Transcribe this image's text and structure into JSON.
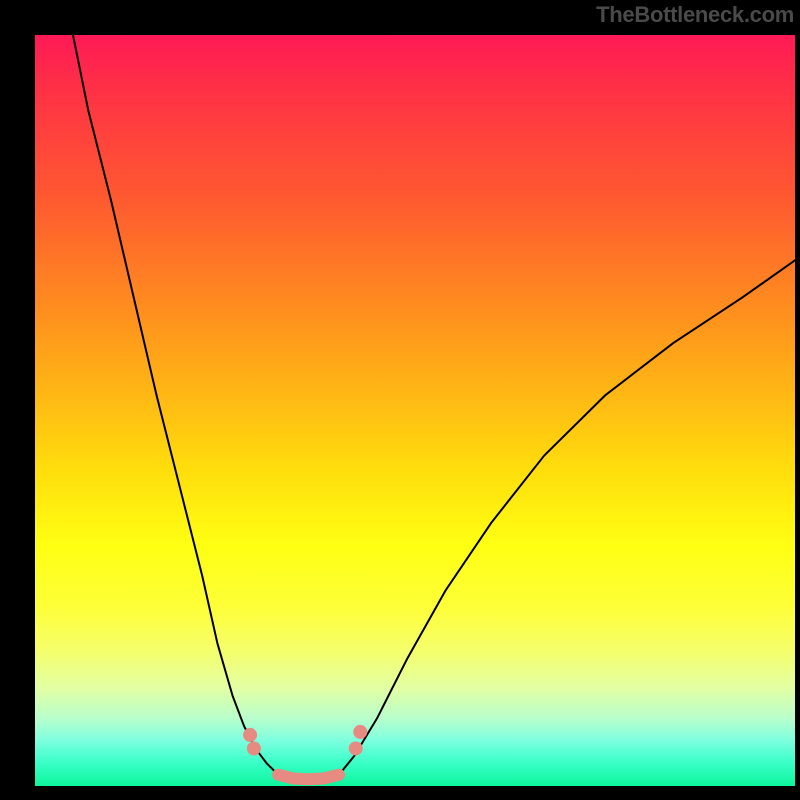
{
  "watermark": "TheBottleneck.com",
  "chart_data": {
    "type": "line",
    "title": "",
    "xlabel": "",
    "ylabel": "",
    "xlim": [
      0,
      100
    ],
    "ylim": [
      0,
      100
    ],
    "background": "rainbow-gradient",
    "series": [
      {
        "name": "left-curve",
        "x": [
          5,
          7,
          10,
          13,
          16,
          19,
          22,
          24,
          26,
          27.5,
          29,
          30.5,
          32
        ],
        "y": [
          100,
          90,
          78,
          65,
          52,
          40,
          28,
          19,
          12,
          8,
          5,
          3,
          1.5
        ],
        "stroke": "#000",
        "width": 2
      },
      {
        "name": "right-curve",
        "x": [
          40,
          42,
          45,
          49,
          54,
          60,
          67,
          75,
          84,
          93,
          100
        ],
        "y": [
          1.5,
          4,
          9,
          17,
          26,
          35,
          44,
          52,
          59,
          65,
          70
        ],
        "stroke": "#000",
        "width": 2
      },
      {
        "name": "bottom-connector",
        "x": [
          32,
          34,
          36,
          38,
          40
        ],
        "y": [
          1.5,
          1.0,
          0.9,
          1.0,
          1.5
        ],
        "stroke": "#e68a82",
        "width": 12
      },
      {
        "name": "left-beads",
        "type": "scatter",
        "x": [
          28.3,
          28.8
        ],
        "y": [
          6.8,
          5.0
        ],
        "marker_color": "#e68a82",
        "marker_size": 14
      },
      {
        "name": "right-beads",
        "type": "scatter",
        "x": [
          42.2,
          42.8
        ],
        "y": [
          5.0,
          7.2
        ],
        "marker_color": "#e68a82",
        "marker_size": 14
      }
    ]
  }
}
